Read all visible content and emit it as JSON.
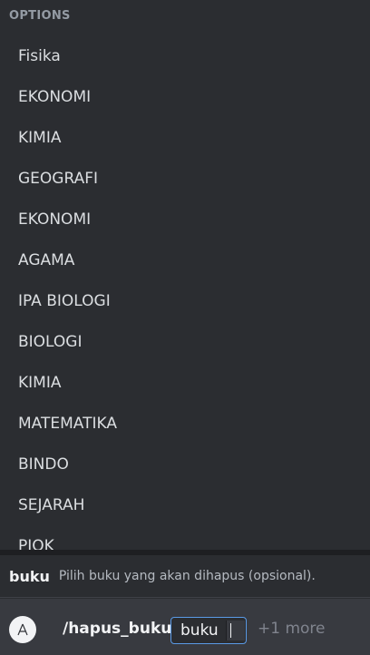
{
  "options": {
    "header": "OPTIONS",
    "items": [
      "Fisika",
      "EKONOMI",
      "KIMIA",
      "GEOGRAFI",
      "EKONOMI",
      "AGAMA",
      "IPA BIOLOGI",
      "BIOLOGI",
      "KIMIA",
      "MATEMATIKA",
      "BINDO",
      "SEJARAH",
      "PJOK"
    ]
  },
  "hint": {
    "param_name": "buku",
    "param_description": "Pilih buku yang akan dihapus (opsional)."
  },
  "command": {
    "app_icon": "bot-avatar-icon",
    "name": "/hapus_buku",
    "param_label": "buku",
    "more_label": "+1 more"
  }
}
